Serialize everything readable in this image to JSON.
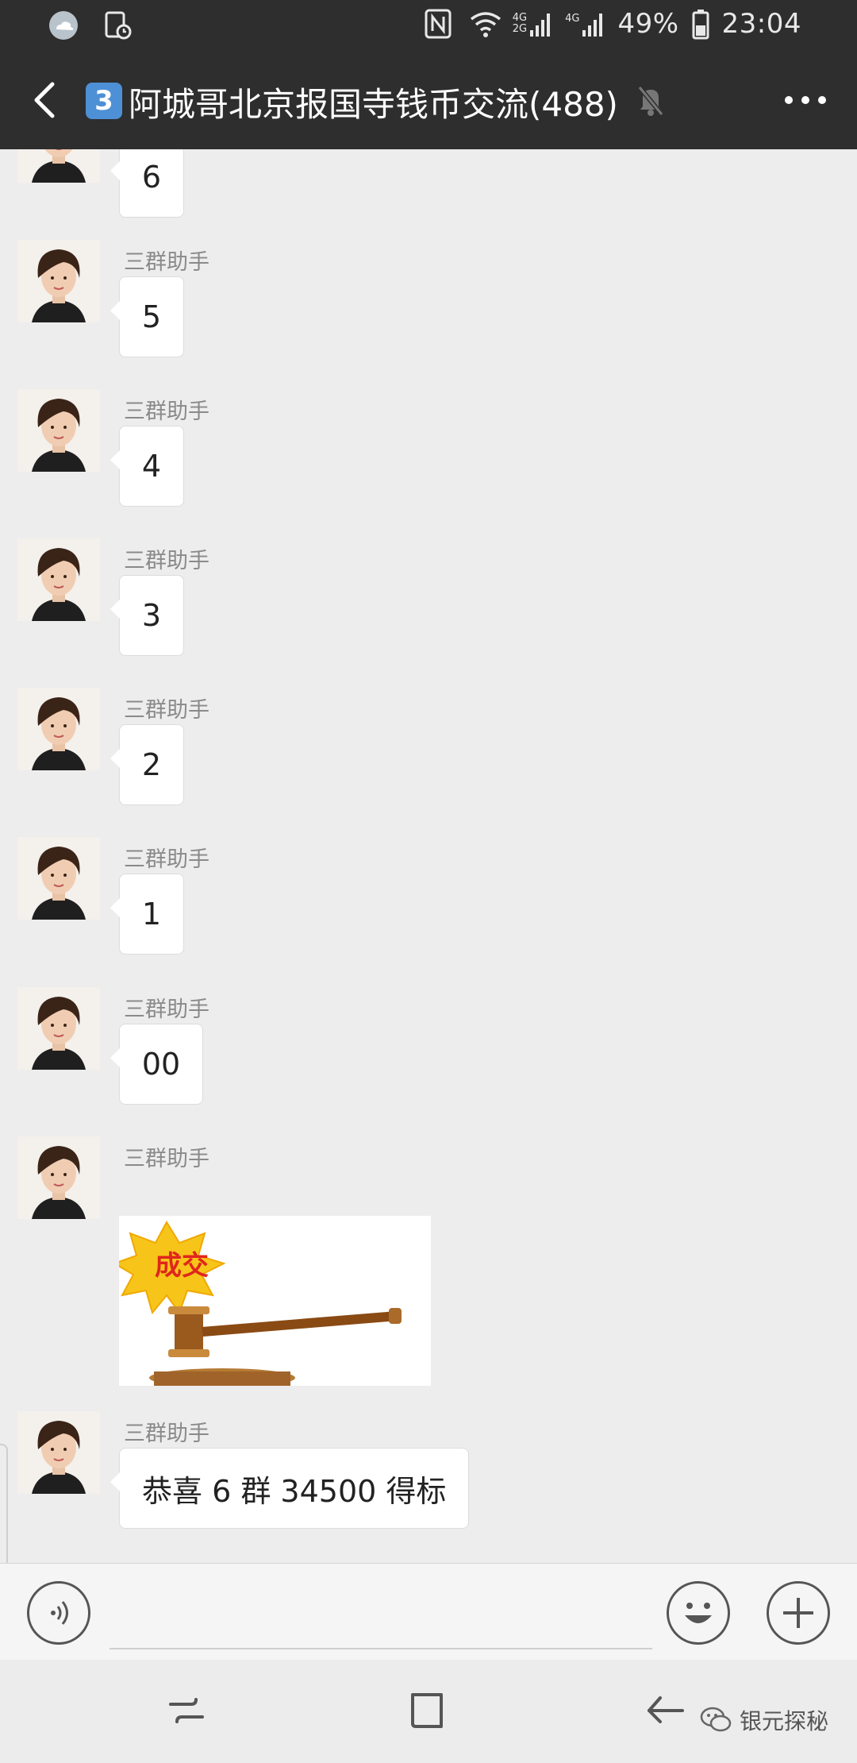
{
  "status_bar": {
    "network": "4G",
    "network2": "2G",
    "battery_percent": "49%",
    "time": "23:04"
  },
  "header": {
    "badge": "3",
    "title": "阿城哥北京报国寺钱币交流(488)"
  },
  "messages": [
    {
      "sender": "",
      "text": "6"
    },
    {
      "sender": "三群助手",
      "text": "5"
    },
    {
      "sender": "三群助手",
      "text": "4"
    },
    {
      "sender": "三群助手",
      "text": "3"
    },
    {
      "sender": "三群助手",
      "text": "2"
    },
    {
      "sender": "三群助手",
      "text": "1"
    },
    {
      "sender": "三群助手",
      "text": "00"
    },
    {
      "sender": "三群助手",
      "image_caption": "成交"
    },
    {
      "sender": "三群助手",
      "text": "恭喜 6 群 34500 得标"
    }
  ],
  "input": {
    "placeholder": ""
  },
  "watermark": "银元探秘",
  "colors": {
    "header_bg": "#2e2e2e",
    "chat_bg": "#ededed",
    "bubble_bg": "#ffffff",
    "sender_text": "#8a8a8a"
  }
}
